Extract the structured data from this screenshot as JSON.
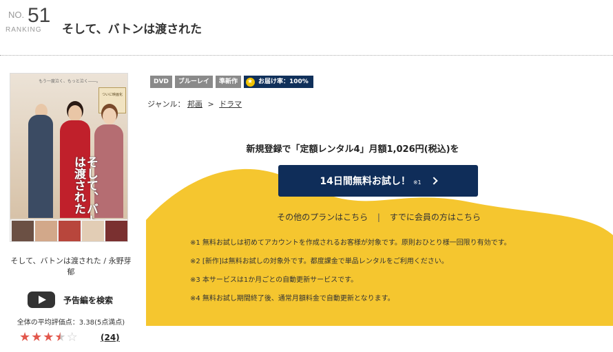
{
  "header": {
    "rank_prefix": "NO.",
    "rank_number": "51",
    "rank_label": "RANKING",
    "title": "そして、バトンは渡された"
  },
  "cover": {
    "tagline": "もう一度泣く、もっと泣く――。",
    "vertical_title": "そして、バトンは渡された",
    "badge_text": "ついに映画化"
  },
  "item": {
    "title_line": "そして、バトンは渡された / 永野芽郁",
    "trailer_label": "予告編を検索",
    "avg_rating": "全体の平均評価点：3.38(5点満点)",
    "rating_value": 3.38,
    "rating_max": 5,
    "review_count": "(24)"
  },
  "tags": {
    "dvd": "DVD",
    "bluray": "ブルーレイ",
    "new": "準新作",
    "delivery": "お届け率：100%"
  },
  "genre": {
    "label": "ジャンル：",
    "primary": "邦画",
    "arrow": ">",
    "secondary": "ドラマ"
  },
  "plan": {
    "headline": "新規登録で「定額レンタル4」月額1,026円(税込)を",
    "cta_label": "14日間無料お試し！",
    "cta_note": "※1",
    "other_plans": "その他のプランはこちら",
    "separator": "|",
    "members": "すでに会員の方はこちら"
  },
  "notes": [
    "※1 無料お試しは初めてアカウントを作成されるお客様が対象です。原則おひとり様一回限り有効です。",
    "※2 [新作]は無料お試しの対象外です。都度課金で単品レンタルをご利用ください。",
    "※3 本サービスは1か月ごとの自動更新サービスです。",
    "※4 無料お試し期間終了後、通常月額料金で自動更新となります。"
  ],
  "colors": {
    "navy": "#0f2d59",
    "yellow": "#f5c62f",
    "star": "#e2574c",
    "tag_gray": "#8a8a8a"
  }
}
